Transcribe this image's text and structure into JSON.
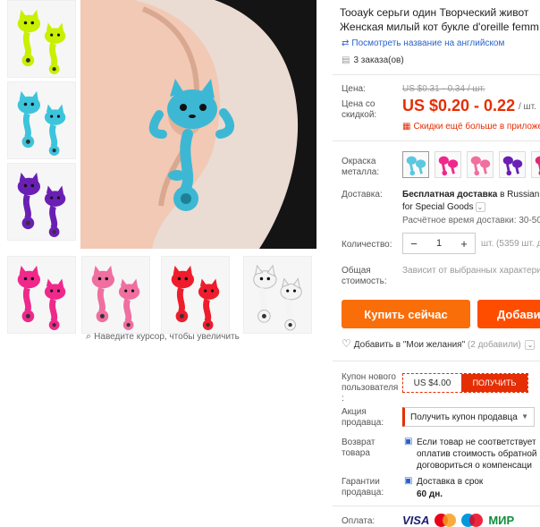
{
  "gallery": {
    "thumbs": [
      {
        "name": "thumb-yellow",
        "color": "#c8f000"
      },
      {
        "name": "thumb-cyan",
        "color": "#3cc4dc"
      },
      {
        "name": "thumb-purple",
        "color": "#6a1fb4"
      },
      {
        "name": "thumb-pink",
        "color": "#f0288c"
      },
      {
        "name": "thumb-lightpink",
        "color": "#f06ea0"
      },
      {
        "name": "thumb-red",
        "color": "#ee1c2c"
      },
      {
        "name": "thumb-white",
        "color": "#f4f4f4"
      }
    ],
    "main_color": "#3cb8d4",
    "zoom_hint": "Наведите курсор, чтобы увеличить"
  },
  "product": {
    "title_line1": "Tooayk серьги один Творческий живот",
    "title_line2": "Женская милый кот букле d'oreille femm",
    "translate_link": "Посмотреть название на английском",
    "orders": "3 заказа(ов)"
  },
  "price": {
    "label": "Цена:",
    "old": "US $0.31 - 0.34 / шт.",
    "discount_label_1": "Цена со",
    "discount_label_2": "скидкой:",
    "new": "US $0.20 - 0.22",
    "unit": "/ шт.",
    "bulk_discount": "Скидки ещё больше в приложе"
  },
  "color": {
    "label_1": "Окраска",
    "label_2": "металла:",
    "swatches": [
      {
        "name": "swatch-cyan",
        "color": "#5ac8e0"
      },
      {
        "name": "swatch-pink",
        "color": "#f0288c"
      },
      {
        "name": "swatch-lightpink",
        "color": "#f06ea0"
      },
      {
        "name": "swatch-purple",
        "color": "#6a1fb4"
      },
      {
        "name": "swatch-magenta",
        "color": "#e0287a"
      }
    ]
  },
  "shipping": {
    "label": "Доставка:",
    "line1_bold": "Бесплатная доставка",
    "line1_rest": " в Russian",
    "line2": "for Special Goods",
    "estimate": "Расчётное время доставки: 30-50"
  },
  "quantity": {
    "label": "Количество:",
    "minus": "−",
    "value": "1",
    "plus": "+",
    "available": "шт. (5359 шт. д"
  },
  "total": {
    "label_1": "Общая",
    "label_2": "стоимость:",
    "value": "Зависит от выбранных характери"
  },
  "actions": {
    "buy_now": "Купить сейчас",
    "add_to_cart": "Добави"
  },
  "wishlist": {
    "label": "Добавить в \"Мои желания\"",
    "count": "(2 добавили)"
  },
  "coupon": {
    "label_1": "Купон нового",
    "label_2": "пользователя",
    "label_3": ":",
    "amount": "US $4.00",
    "get": "ПОЛУЧИТЬ"
  },
  "seller": {
    "label_1": "Акция",
    "label_2": "продавца:",
    "coupon_select": "Получить купон продавца"
  },
  "returns": {
    "label_1": "Возврат",
    "label_2": "товара",
    "line1": "Если товар не соответствует",
    "line2": "оплатив стоимость обратной",
    "line3": "договориться о компенсаци"
  },
  "guarantee": {
    "label_1": "Гарантии",
    "label_2": "продавца:",
    "line1": "Доставка в срок",
    "line2": "60 дн."
  },
  "payment": {
    "label": "Оплата:",
    "visa": "VISA",
    "mir": "МИР"
  },
  "icons": {
    "zoom": "⌕",
    "translate": "⇄",
    "orders": "▤",
    "discount": "▦",
    "heart": "♡",
    "chevron": "⌄",
    "caret": "▼",
    "shield": "▣"
  }
}
